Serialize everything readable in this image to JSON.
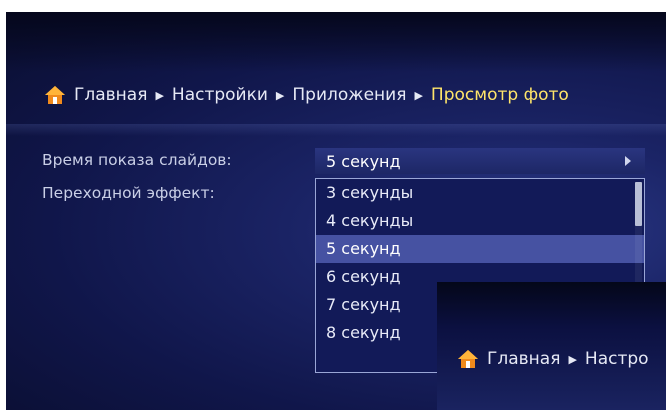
{
  "breadcrumb": {
    "items": [
      "Главная",
      "Настройки",
      "Приложения",
      "Просмотр фото"
    ],
    "icon": "home-icon"
  },
  "settings": {
    "slideshow_time_label": "Время показа слайдов:",
    "transition_effect_label": "Переходной эффект:",
    "slideshow_time_value": "5 секунд"
  },
  "dropdown": {
    "options": [
      "3 секунды",
      "4 секунды",
      "5 секунд",
      "6 секунд",
      "7 секунд",
      "8 секунд"
    ],
    "selected_index": 2,
    "scroll_position": 0
  },
  "overlay": {
    "breadcrumb": [
      "Главная",
      "Настро"
    ]
  },
  "colors": {
    "current_crumb": "#ffe56a",
    "selected_option": "#4652a2",
    "background": "#10164a"
  }
}
